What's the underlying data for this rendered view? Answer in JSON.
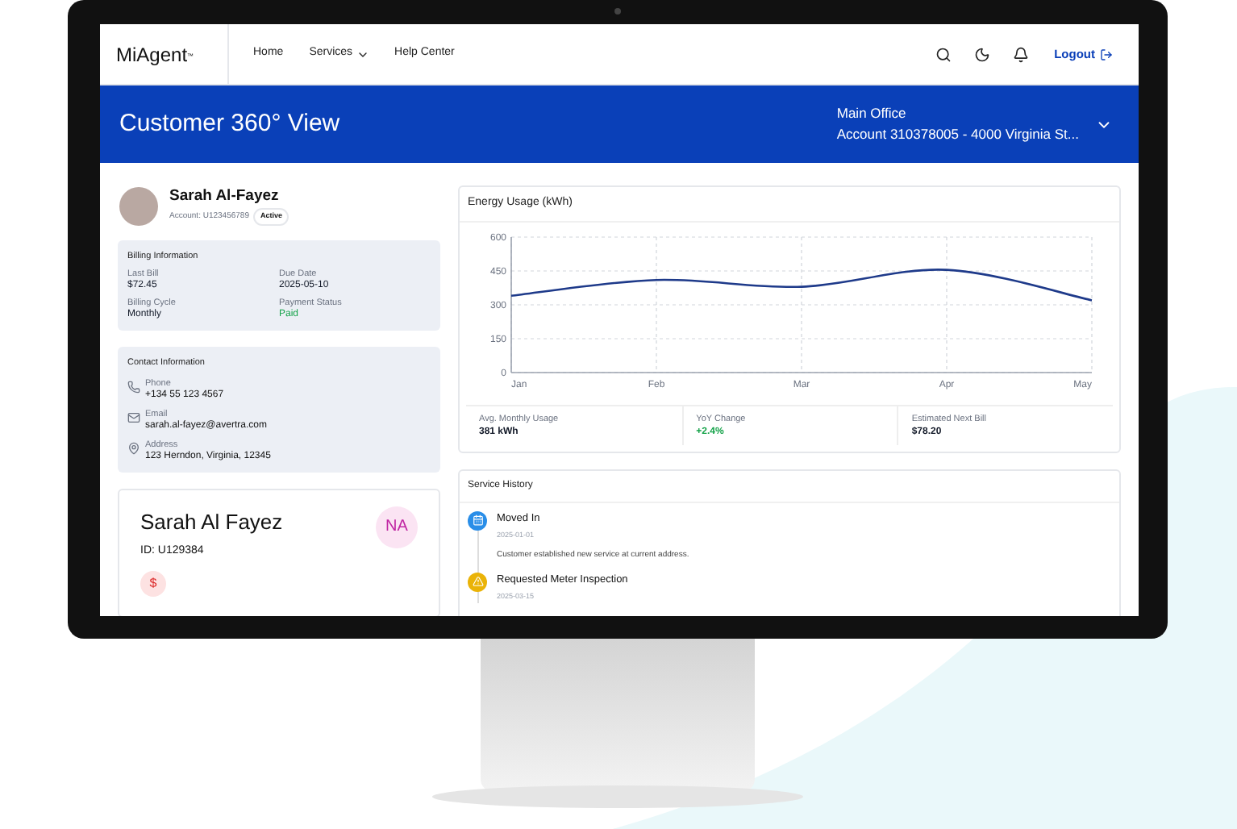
{
  "nav": {
    "logo": "MiAgent",
    "logo_mark": "™",
    "links": [
      {
        "label": "Home",
        "dropdown": false
      },
      {
        "label": "Services",
        "dropdown": true
      },
      {
        "label": "Help Center",
        "dropdown": false
      }
    ],
    "logout": "Logout"
  },
  "banner": {
    "title": "Customer 360° View",
    "office": "Main Office",
    "account": "Account 310378005 - 4000 Virginia St..."
  },
  "profile": {
    "name": "Sarah Al-Fayez",
    "account": "Account: U123456789",
    "status": "Active"
  },
  "billing": {
    "title": "Billing Information",
    "fields": [
      {
        "label": "Last Bill",
        "value": "$72.45",
        "kind": "plain"
      },
      {
        "label": "Due Date",
        "value": "2025-05-10",
        "kind": "plain"
      },
      {
        "label": "Billing Cycle",
        "value": "Monthly",
        "kind": "plain"
      },
      {
        "label": "Payment Status",
        "value": "Paid",
        "kind": "good"
      }
    ]
  },
  "contact": {
    "title": "Contact Information",
    "items": [
      {
        "kind": "phone",
        "label": "Phone",
        "value": "+134 55 123 4567"
      },
      {
        "kind": "email",
        "label": "Email",
        "value": "sarah.al-fayez@avertra.com"
      },
      {
        "kind": "address",
        "label": "Address",
        "value": "123 Herndon, Virginia, 12345"
      }
    ]
  },
  "card": {
    "name": "Sarah Al Fayez",
    "id": "ID: U129384",
    "initials": "NA",
    "symbol": "$"
  },
  "energy": {
    "title": "Energy Usage (kWh)",
    "chart_data": {
      "type": "line",
      "categories": [
        "Jan",
        "Feb",
        "Mar",
        "Apr",
        "May"
      ],
      "series": [
        {
          "color": "#1e3a8a",
          "values": [
            340,
            410,
            380,
            455,
            320
          ]
        }
      ],
      "grid": true,
      "ylim": [
        0,
        600
      ],
      "yticks": [
        0,
        150,
        300,
        450,
        600
      ]
    },
    "stats": [
      {
        "label": "Avg. Monthly Usage",
        "value": "381 kWh",
        "kind": "plain"
      },
      {
        "label": "YoY Change",
        "value": "+2.4%",
        "kind": "good"
      },
      {
        "label": "Estimated Next Bill",
        "value": "$78.20",
        "kind": "plain"
      }
    ]
  },
  "history": {
    "title": "Service History",
    "items": [
      {
        "kind": "move",
        "title": "Moved In",
        "date": "2025-01-01",
        "note": "Customer established new service at current address."
      },
      {
        "kind": "warning",
        "title": "Requested Meter Inspection",
        "date": "2025-03-15"
      }
    ]
  }
}
